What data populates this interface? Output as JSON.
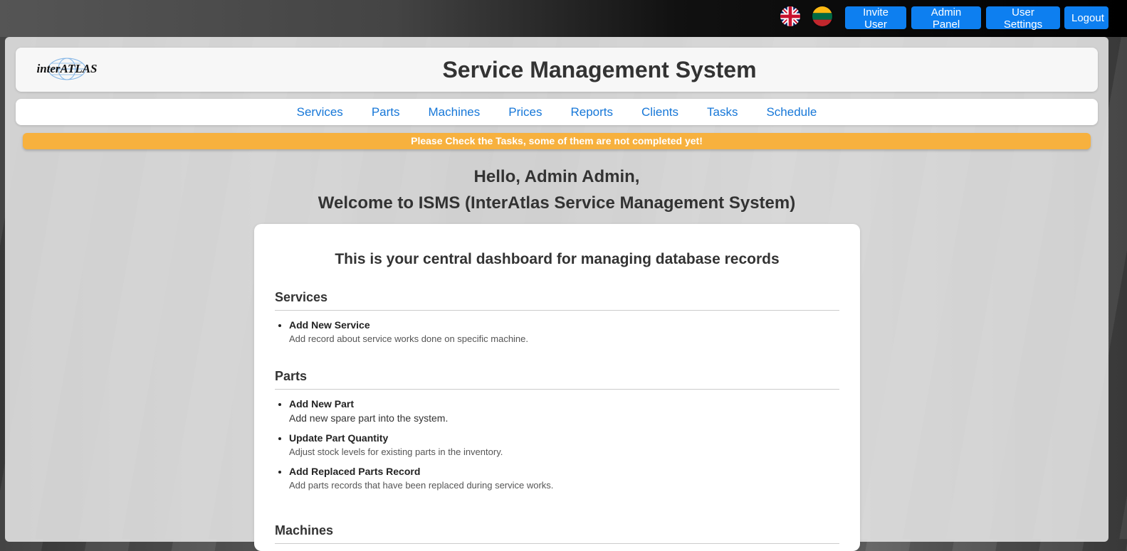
{
  "topbar": {
    "languages": [
      {
        "name": "uk-flag-icon"
      },
      {
        "name": "lt-flag-icon"
      }
    ],
    "buttons": {
      "invite": "Invite User",
      "admin": "Admin Panel",
      "settings": "User Settings",
      "logout": "Logout"
    }
  },
  "header": {
    "logo_text": "interATLAS",
    "title": "Service Management System"
  },
  "nav": [
    "Services",
    "Parts",
    "Machines",
    "Prices",
    "Reports",
    "Clients",
    "Tasks",
    "Schedule"
  ],
  "alert": "Please Check the Tasks, some of them are not completed yet!",
  "greeting": {
    "line1": "Hello, Admin Admin,",
    "line2": "Welcome to ISMS (InterAtlas Service Management System)"
  },
  "dashboard": {
    "title": "This is your central dashboard for managing database records",
    "services": {
      "heading": "Services",
      "items": [
        {
          "title": "Add New Service",
          "desc": "Add record about service works done on specific machine."
        }
      ]
    },
    "parts": {
      "heading": "Parts",
      "items": [
        {
          "title": "Add New Part",
          "desc": "Add new spare part into the system."
        },
        {
          "title": "Update Part Quantity",
          "desc": "Adjust stock levels for existing parts in the inventory."
        },
        {
          "title": "Add Replaced Parts Record",
          "desc": "Add parts records that have been replaced during service works."
        }
      ]
    },
    "machines": {
      "heading": "Machines"
    }
  },
  "colors": {
    "primary_button": "#0d7ff0",
    "nav_link": "#1677d8",
    "alert": "#f7b13e"
  }
}
